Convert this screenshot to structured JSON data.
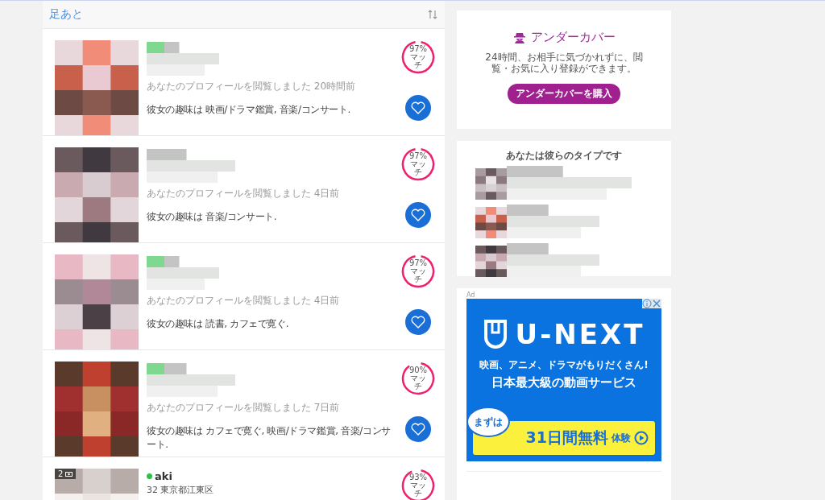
{
  "footprints": {
    "title": "足あと",
    "rows": [
      {
        "kind": "blurred",
        "viewed": "あなたのプロフィールを閲覧しました 20時間前",
        "hobbies": "彼女の趣味は 映画/ドラマ鑑賞, 音楽/コンサート.",
        "match": "97%",
        "match_label": "マッチ",
        "level": 0.97
      },
      {
        "kind": "blurred",
        "viewed": "あなたのプロフィールを閲覧しました 4日前",
        "hobbies": "彼女の趣味は 音楽/コンサート.",
        "match": "97%",
        "match_label": "マッチ",
        "level": 0.97
      },
      {
        "kind": "blurred",
        "viewed": "あなたのプロフィールを閲覧しました 4日前",
        "hobbies": "彼女の趣味は 読書, カフェで寛ぐ.",
        "match": "97%",
        "match_label": "マッチ",
        "level": 0.97
      },
      {
        "kind": "blurred",
        "viewed": "あなたのプロフィールを閲覧しました 7日前",
        "hobbies": "彼女の趣味は カフェで寛ぐ, 映画/ドラマ鑑賞, 音楽/コンサート.",
        "match": "90%",
        "match_label": "マッチ",
        "level": 0.9
      },
      {
        "kind": "profile",
        "online": true,
        "name": "aki",
        "age_location": "32 東京都江東区",
        "photo_count": "2",
        "match": "93%",
        "match_label": "マッチ",
        "level": 0.93
      }
    ]
  },
  "undercover": {
    "title": "アンダーカバー",
    "text": "24時間、お相手に気づかれずに、閲覧・お気に入り登録ができます。",
    "button": "アンダーカバーを購入"
  },
  "your_type": {
    "title": "あなたは彼らのタイプです"
  },
  "ad": {
    "label": "Ad",
    "brand": "U-NEXT",
    "tagline": "映画、アニメ、ドラマがもりだくさん!",
    "headline": "日本最大級の動画サービス",
    "bubble": "まずは",
    "offer": "31日間無料",
    "offer_suffix": "体験"
  }
}
